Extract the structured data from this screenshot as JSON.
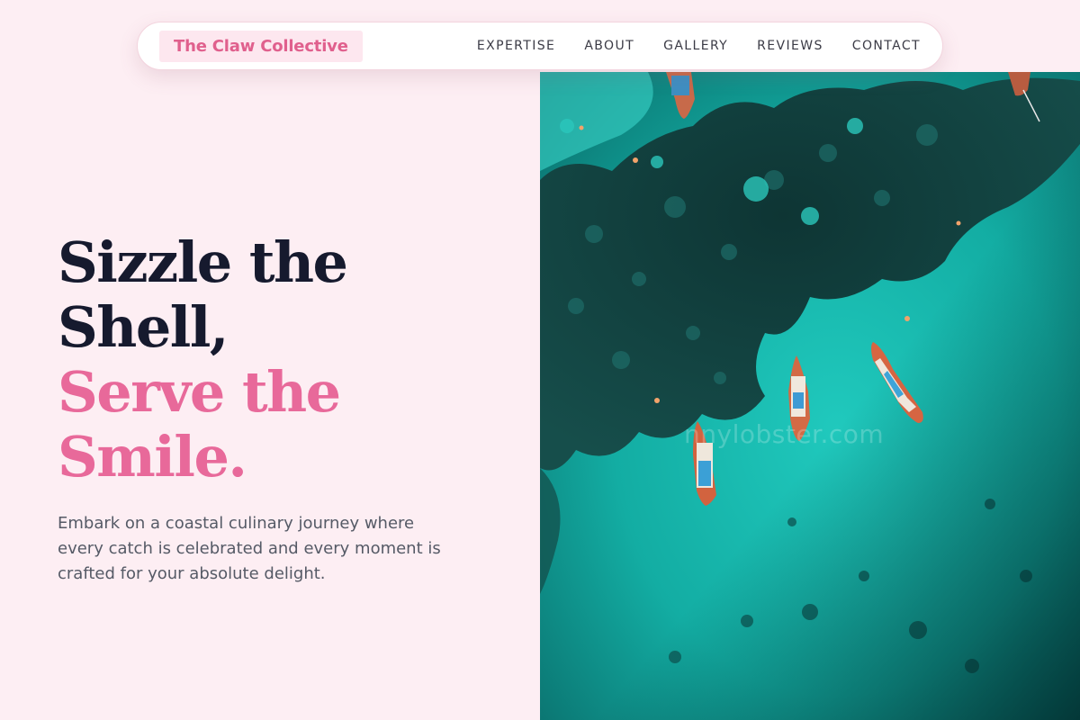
{
  "nav": {
    "brand": "The Claw Collective",
    "links": [
      "EXPERTISE",
      "ABOUT",
      "GALLERY",
      "REVIEWS",
      "CONTACT"
    ]
  },
  "hero": {
    "headline_line1": "Sizzle the",
    "headline_line2": "Shell,",
    "headline_line3": "Serve the",
    "headline_line4": "Smile.",
    "description": "Embark on a coastal culinary journey where every catch is celebrated and every moment is crafted for your absolute delight."
  },
  "photo": {
    "subject": "aerial view of longtail boats on turquoise sea over dark reef",
    "watermark": "nnylobster.com"
  },
  "colors": {
    "background": "#fdeef3",
    "accent_pink": "#e8699a",
    "headline_dark": "#161a2e",
    "body_text": "#555a66",
    "sea": "#16b3a8",
    "reef": "#0f3b3a"
  }
}
